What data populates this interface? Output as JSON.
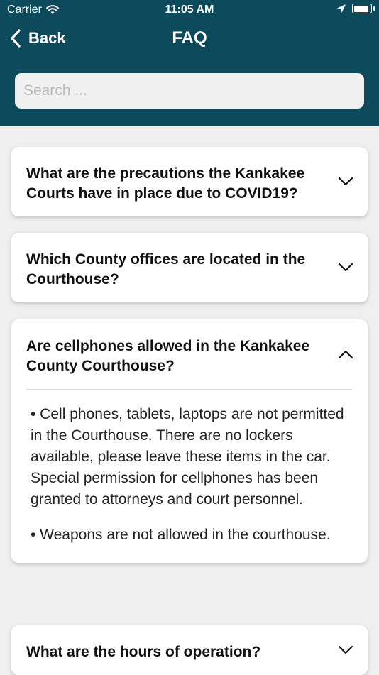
{
  "status_bar": {
    "carrier": "Carrier",
    "time": "11:05 AM"
  },
  "nav": {
    "back_label": "Back",
    "title": "FAQ"
  },
  "search": {
    "placeholder": "Search ..."
  },
  "faq": {
    "items": [
      {
        "question": "What are the precautions the Kankakee Courts have in place due to COVID19?",
        "expanded": false
      },
      {
        "question": "Which County offices are located in the Courthouse?",
        "expanded": false
      },
      {
        "question": "Are cellphones allowed in the Kankakee County Courthouse?",
        "expanded": true,
        "answer": [
          "• Cell phones, tablets, laptops are not permitted in the Courthouse. There are no lockers available, please leave these items in the car. Special permission for cellphones has been granted to attorneys and court personnel.",
          "• Weapons are not allowed in the courthouse."
        ]
      },
      {
        "question": "What are the hours of operation?",
        "expanded": false
      }
    ]
  },
  "colors": {
    "header_bg": "#0d4a5b",
    "page_bg": "#efefef",
    "card_bg": "#ffffff"
  }
}
